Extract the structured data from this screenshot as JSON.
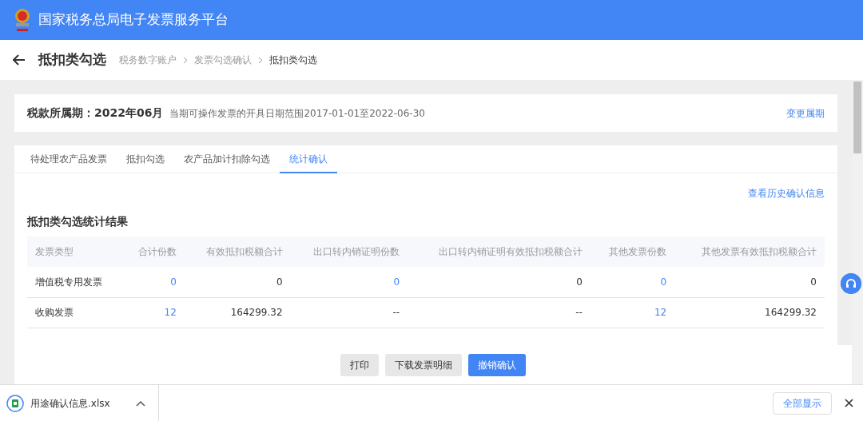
{
  "header": {
    "title": "国家税务总局电子发票服务平台"
  },
  "page": {
    "title": "抵扣类勾选",
    "breadcrumb": [
      {
        "label": "税务数字账户",
        "current": false
      },
      {
        "label": "发票勾选确认",
        "current": false
      },
      {
        "label": "抵扣类勾选",
        "current": true
      }
    ]
  },
  "period": {
    "label": "税款所属期：",
    "value": "2022年06月",
    "note": "当期可操作发票的开具日期范围2017-01-01至2022-06-30",
    "action": "变更属期"
  },
  "tabs": [
    {
      "label": "待处理农产品发票",
      "selected": false
    },
    {
      "label": "抵扣勾选",
      "selected": false
    },
    {
      "label": "农产品加计扣除勾选",
      "selected": false
    },
    {
      "label": "统计确认",
      "selected": true
    }
  ],
  "history_link": "查看历史确认信息",
  "section_title": "抵扣类勾选统计结果",
  "table": {
    "columns": [
      "发票类型",
      "合计份数",
      "有效抵扣税额合计",
      "出口转内销证明份数",
      "出口转内销证明有效抵扣税额合计",
      "其他发票份数",
      "其他发票有效抵扣税额合计"
    ],
    "rows": [
      [
        "增值税专用发票",
        "0",
        "0",
        "0",
        "0",
        "0",
        "0"
      ],
      [
        "收购发票",
        "12",
        "164299.32",
        "--",
        "--",
        "12",
        "164299.32"
      ]
    ]
  },
  "actions": [
    {
      "label": "打印",
      "primary": false
    },
    {
      "label": "下载发票明细",
      "primary": false
    },
    {
      "label": "撤销确认",
      "primary": true
    }
  ],
  "download_bar": {
    "file": "用途确认信息.xlsx",
    "show_all": "全部显示"
  }
}
